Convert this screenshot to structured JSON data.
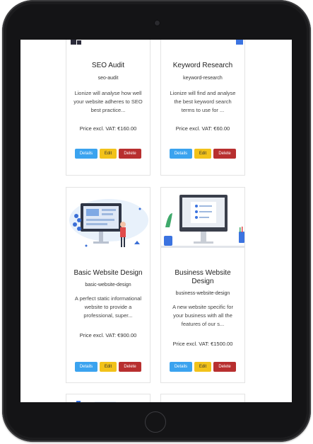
{
  "colors": {
    "details": "#3ba3ef",
    "edit": "#f2c21a",
    "delete": "#b82f2f"
  },
  "cards": [
    {
      "title": "SEO Audit",
      "slug": "seo-audit",
      "description": "Lionize will analyse how well your website adheres to SEO best practice...",
      "price": "Price excl. VAT: €160.00",
      "details": "Details",
      "edit": "Edit",
      "delete": "Delete"
    },
    {
      "title": "Keyword Research",
      "slug": "keyword-research",
      "description": "Lionize will find and analyse the best keyword search terms to use for ...",
      "price": "Price excl. VAT: €60.00",
      "details": "Details",
      "edit": "Edit",
      "delete": "Delete"
    },
    {
      "title": "Basic Website Design",
      "slug": "basic-website-design",
      "description": "A perfect static informational website to provide a professional, super...",
      "price": "Price excl. VAT: €900.00",
      "details": "Details",
      "edit": "Edit",
      "delete": "Delete"
    },
    {
      "title": "Business Website Design",
      "slug": "business-website-design",
      "description": "A new website specific for your business with all the features of our s...",
      "price": "Price excl. VAT: €1500.00",
      "details": "Details",
      "edit": "Edit",
      "delete": "Delete"
    }
  ]
}
